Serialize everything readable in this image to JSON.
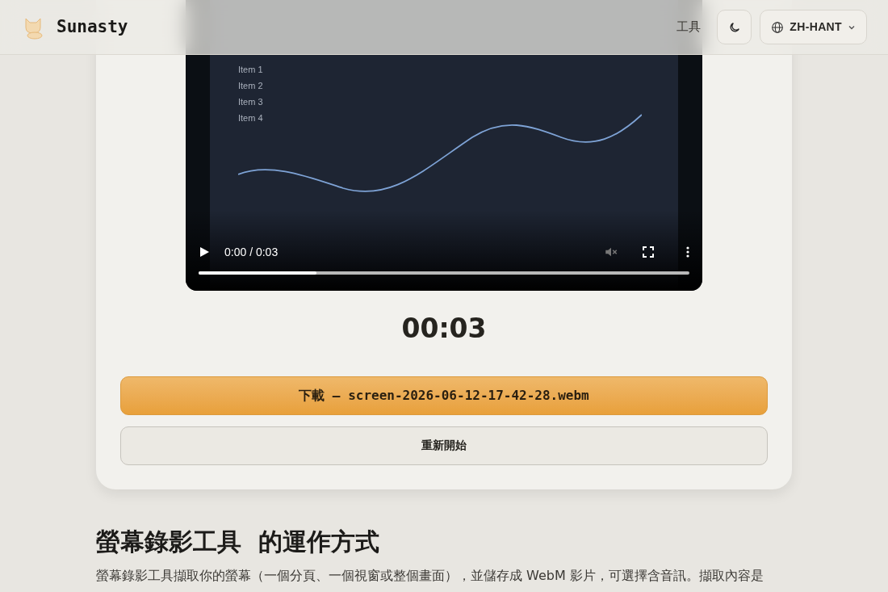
{
  "header": {
    "brand": "Sunasty",
    "nav_link": "工具",
    "language_button": {
      "label": "ZH-HANT"
    }
  },
  "video": {
    "frame": {
      "items": [
        "Item 1",
        "Item 2",
        "Item 3",
        "Item 4"
      ]
    },
    "time": "0:00 / 0:03",
    "muted": true,
    "progress": {
      "level": 0.24
    }
  },
  "timer": "00:03",
  "download_button": {
    "label": "下載 — screen-2026-06-12-17-42-28.webm"
  },
  "restart_button": {
    "label": "重新開始"
  },
  "section": {
    "heading": "螢幕錄影工具  的運作方式",
    "paragraph": "螢幕錄影工具擷取你的螢幕（一個分頁、一個視窗或整個畫面），並儲存成 WebM 影片，可選擇含音訊。擷取內容是"
  }
}
